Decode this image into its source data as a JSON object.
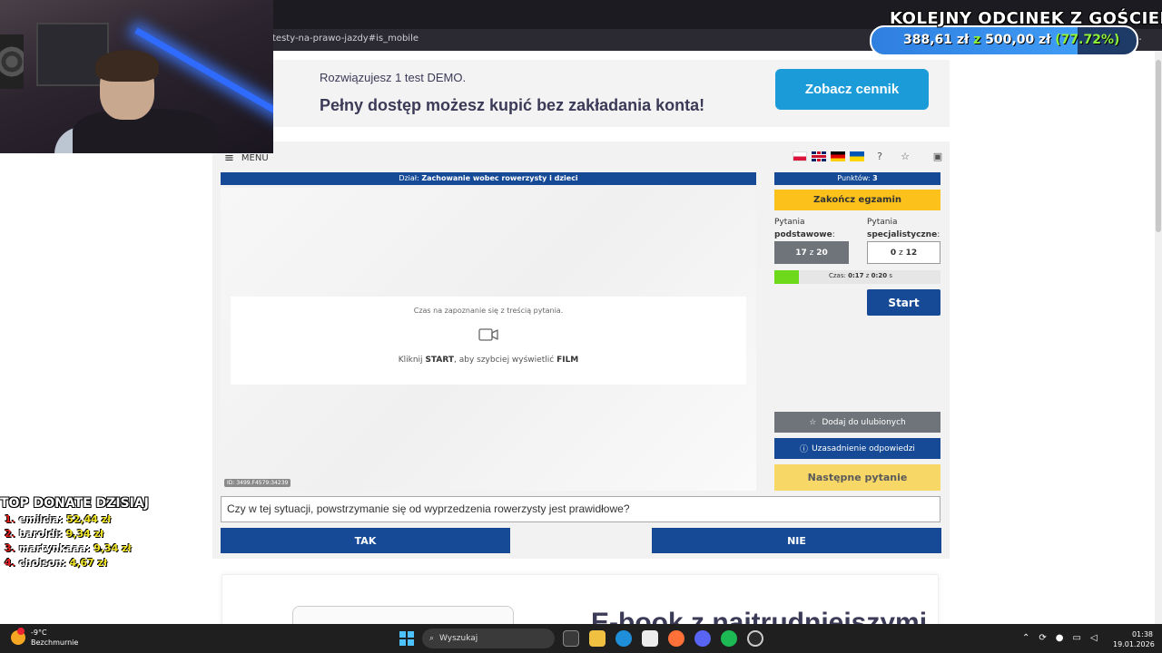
{
  "browser": {
    "url": "testy-na-prawo-jazdy#is_mobile"
  },
  "demo": {
    "line1": "Rozwiązujesz 1 test DEMO.",
    "line2": "Pełny dostęp możesz kupić bez zakładania konta!",
    "pricing_button": "Zobacz cennik"
  },
  "exam": {
    "menu_label": "MENU",
    "section_prefix": "Dział:",
    "section_name": "Zachowanie wobec rowerzysty i dzieci",
    "points_prefix": "Punktów:",
    "points_value": "3",
    "finish_button": "Zakończ egzamin",
    "basic_label_1": "Pytania",
    "basic_label_2": "podstawowe",
    "basic_current": "17",
    "basic_of": "z",
    "basic_total": "20",
    "spec_label_1": "Pytania",
    "spec_label_2": "specjalistyczne",
    "spec_current": "0",
    "spec_of": "z",
    "spec_total": "12",
    "timer_label": "Czas:",
    "timer_current": "0:17",
    "timer_of": "z",
    "timer_total": "0:20",
    "timer_unit": "s",
    "timer_progress": 0.15,
    "start_button": "Start",
    "media_hint": "Czas na zapoznanie się z treścią pytania.",
    "media_cta_1": "Kliknij",
    "media_cta_start": "START",
    "media_cta_2": ", aby szybciej wyświetlić",
    "media_cta_film": "FILM",
    "media_id": "ID: 3499.F4579:34239",
    "favorite_button": "Dodaj do ulubionych",
    "explain_button": "Uzasadnienie odpowiedzi",
    "next_button": "Następne pytanie",
    "question": "Czy w tej sytuacji, powstrzymanie się od wyprzedzenia rowerzysty jest prawidłowe?",
    "answer_yes": "TAK",
    "answer_no": "NIE"
  },
  "ebook": {
    "title": "E-book z najtrudniejszymi"
  },
  "overlay": {
    "goal_title": "KOLEJNY ODCINEK Z GOŚCIEM",
    "goal_current": "388,61 zł",
    "goal_sep": "z",
    "goal_target": "500,00 zł",
    "goal_percent": "(77.72%)",
    "goal_progress": 0.7772,
    "donate_title": "TOP DONATE DZISIAJ",
    "donors": [
      {
        "rank": "1.",
        "name": "emilcia:",
        "amount": "52,44 zł"
      },
      {
        "rank": "2.",
        "name": "baroldi:",
        "amount": "9,34 zł"
      },
      {
        "rank": "3.",
        "name": "martynkaaa:",
        "amount": "9,34 zł"
      },
      {
        "rank": "4.",
        "name": "cholson:",
        "amount": "4,67 zł"
      }
    ]
  },
  "taskbar": {
    "temp": "-9°C",
    "weather": "Bezchmurnie",
    "search": "Wyszukaj",
    "time": "01:38",
    "date": "19.01.2026"
  },
  "colors": {
    "primary": "#164a96",
    "accent": "#fcc21b",
    "pricing": "#1b9bd8",
    "timer": "#6dd91a"
  }
}
